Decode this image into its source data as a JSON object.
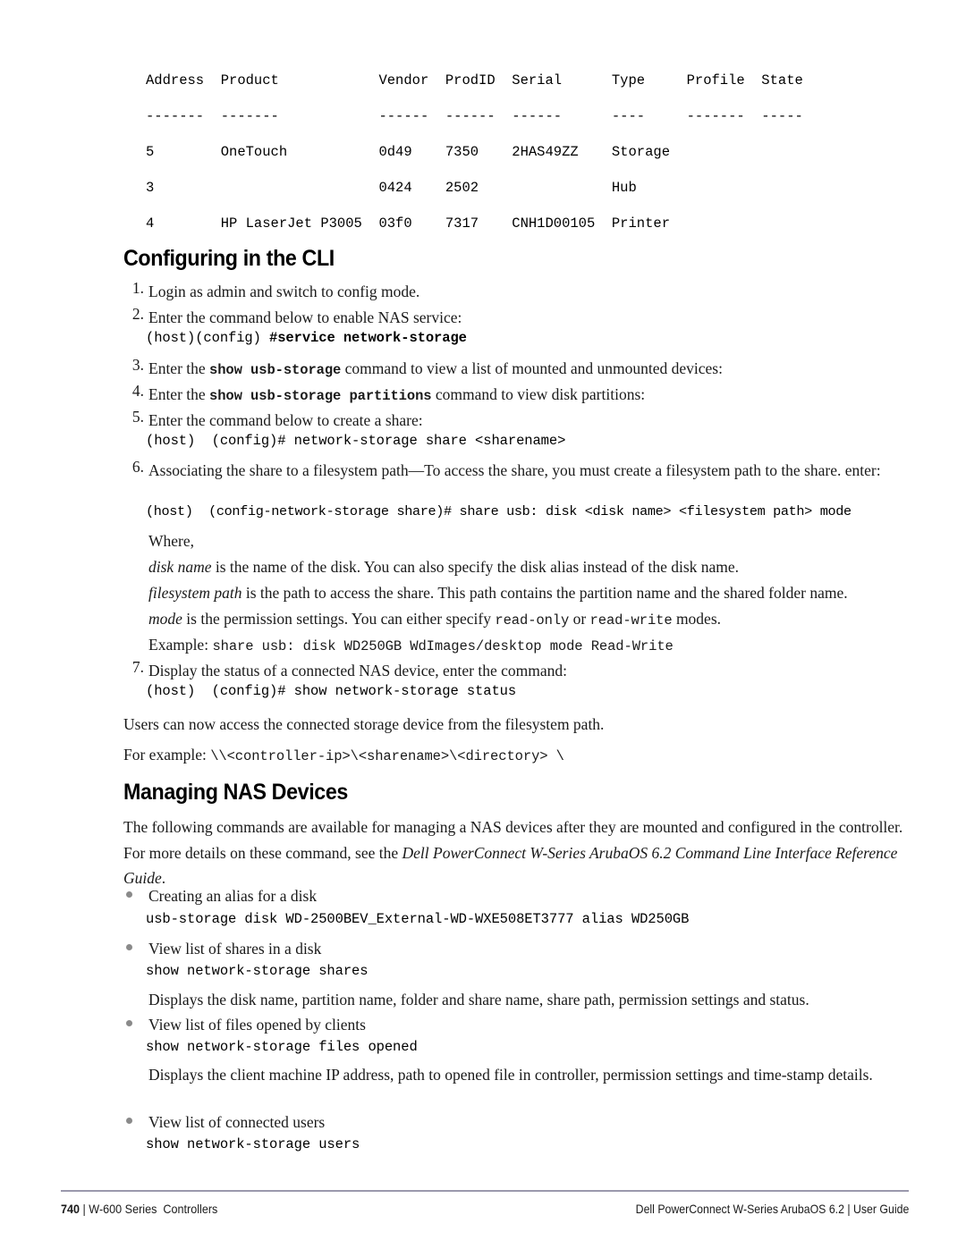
{
  "cli_output": {
    "lines": [
      "Address  Product            Vendor  ProdID  Serial      Type     Profile  State",
      "-------  -------            ------  ------  ------      ----     -------  -----",
      "5        OneTouch           0d49    7350    2HAS49ZZ    Storage",
      "3                           0424    2502                Hub",
      "4        HP LaserJet P3005  03f0    7317    CNH1D00105  Printer"
    ],
    "columns": [
      "Address",
      "Product",
      "Vendor",
      "ProdID",
      "Serial",
      "Type",
      "Profile",
      "State"
    ],
    "rows": [
      {
        "address": "5",
        "product": "OneTouch",
        "vendor": "0d49",
        "prodid": "7350",
        "serial": "2HAS49ZZ",
        "type": "Storage",
        "profile": "",
        "state": ""
      },
      {
        "address": "3",
        "product": "",
        "vendor": "0424",
        "prodid": "2502",
        "serial": "",
        "type": "Hub",
        "profile": "",
        "state": ""
      },
      {
        "address": "4",
        "product": "HP LaserJet P3005",
        "vendor": "03f0",
        "prodid": "7317",
        "serial": "CNH1D00105",
        "type": "Printer",
        "profile": "",
        "state": ""
      }
    ]
  },
  "headings": {
    "configuring_cli": "Configuring in the CLI",
    "managing_nas": "Managing NAS Devices"
  },
  "cli_steps": {
    "n1": "1.",
    "t1": "Login as admin and switch to config mode.",
    "n2": "2.",
    "t2": "Enter the command below to enable NAS service:",
    "code2_prefix": "(host)(config) ",
    "code2_bold": "#service network-storage",
    "n3": "3.",
    "t3_a": "Enter the ",
    "t3_code": "show usb-storage",
    "t3_b": " command to view a list of mounted and unmounted devices:",
    "n4": "4.",
    "t4_a": "Enter the ",
    "t4_code": "show usb-storage partitions",
    "t4_b": " command to view disk partitions:",
    "n5": "5.",
    "t5": "Enter the command below to create a share:",
    "code5": "(host)  (config)# network-storage share <sharename>",
    "n6": "6.",
    "t6": "Associating the share to a filesystem path—To access the share, you must create a filesystem path to the share. enter:",
    "code6": "(host)  (config-network-storage share)# share usb: disk <disk name> <filesystem path> mode",
    "where": "Where,",
    "def1_term": "disk name",
    "def1_rest": " is the name of the disk. You can also specify the disk alias instead of the disk name.",
    "def2_term": "filesystem path",
    "def2_rest": " is the path to access the share. This path contains the partition name and the shared folder name.",
    "def3_term": "mode",
    "def3_a": " is the permission settings. You can either specify ",
    "def3_code1": "read-only",
    "def3_b": " or ",
    "def3_code2": "read-write",
    "def3_c": " modes.",
    "example_label": "Example: ",
    "example_code": "share usb: disk WD250GB WdImages/desktop mode Read-Write",
    "n7": "7.",
    "t7": "Display the status of a connected NAS device, enter the command:",
    "code7": "(host)  (config)# show network-storage status"
  },
  "after_steps": {
    "users_note": "Users can now access the connected storage device from the filesystem path.",
    "example_label": "For example: ",
    "example_code": "\\\\<controller-ip>\\<sharename>\\<directory> \\"
  },
  "managing": {
    "intro_a": "The following commands are available for managing a NAS devices after they are mounted and configured in the controller. For more details on these command, see the ",
    "intro_italic": "Dell PowerConnect W-Series ArubaOS 6.2 Command Line Interface Reference Guide",
    "intro_b": ".",
    "items": [
      {
        "label": "Creating an alias for a disk",
        "command": "usb-storage disk WD-2500BEV_External-WD-WXE508ET3777 alias WD250GB",
        "description": ""
      },
      {
        "label": "View list of shares in a disk",
        "command": "show network-storage shares",
        "description": "Displays the disk name, partition name, folder and share name, share path, permission settings and status."
      },
      {
        "label": "View list of files opened by clients",
        "command": "show network-storage files opened",
        "description": "Displays the client machine IP address, path to opened file in controller, permission settings and time-stamp details."
      },
      {
        "label": "View list of connected users",
        "command": "show network-storage users",
        "description": ""
      }
    ]
  },
  "footer": {
    "page_number": "740",
    "separator": " | ",
    "left_title": "W-600 Series  Controllers",
    "right_text": "Dell PowerConnect W-Series ArubaOS 6.2 | User Guide"
  },
  "colors": {
    "text": "#1a1a1a",
    "rule": "#9a99ad",
    "bullet": "#8a8a8a"
  }
}
